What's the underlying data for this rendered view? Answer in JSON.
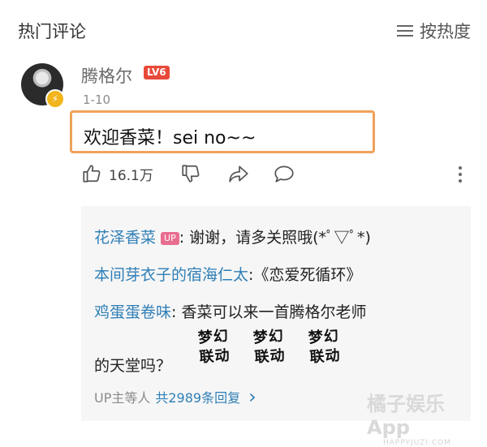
{
  "header": {
    "title": "热门评论",
    "sort_label": "按热度"
  },
  "comment": {
    "username": "腾格尔",
    "level": "LV6",
    "date": "1-10",
    "text": "欢迎香菜！sei no~~",
    "likes": "16.1万"
  },
  "replies": [
    {
      "name": "花泽香菜",
      "up_tag": "UP",
      "text": ": 谢谢，请多关照哦(*ﾟ▽ﾟ*)"
    },
    {
      "name": "本间芽衣子的宿海仁太",
      "text": ":《恋爱死循环》"
    },
    {
      "name": "鸡蛋蛋卷味",
      "text": ": 香菜可以来一首腾格尔老师",
      "text_line2": "的天堂吗？"
    }
  ],
  "stickers": [
    {
      "line1": "梦幻",
      "line2": "联动"
    },
    {
      "line1": "梦幻",
      "line2": "联动"
    },
    {
      "line1": "梦幻",
      "line2": "联动"
    }
  ],
  "reply_footer": {
    "prefix": "UP主等人",
    "count_text": "共2989条回复",
    "arrow": "›"
  },
  "watermark": {
    "main": "橘子娱乐App",
    "sub": "HAPPYJUZI.COM"
  },
  "icons": [
    "sort-icon",
    "verified-badge-icon",
    "thumbs-up-icon",
    "thumbs-down-icon",
    "share-icon",
    "comment-icon",
    "more-icon",
    "chevron-right-icon"
  ],
  "colors": {
    "name_blue": "#2f7fb7",
    "highlight_orange": "#f0a15a",
    "level_red": "#e84a3a",
    "up_pink": "#e86d8f"
  }
}
